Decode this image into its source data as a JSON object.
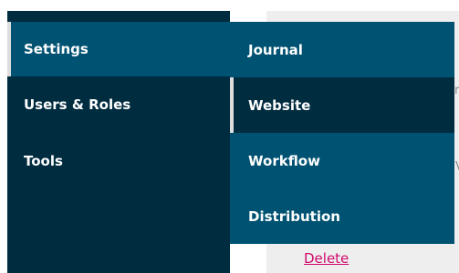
{
  "main_nav": {
    "items": [
      {
        "label": "Settings",
        "active": true
      },
      {
        "label": "Users & Roles",
        "active": false
      },
      {
        "label": "Tools",
        "active": false
      }
    ]
  },
  "settings_submenu": {
    "items": [
      {
        "label": "Journal",
        "active": false
      },
      {
        "label": "Website",
        "active": true
      },
      {
        "label": "Workflow",
        "active": false
      },
      {
        "label": "Distribution",
        "active": false
      }
    ]
  },
  "background": {
    "delete_link": "Delete",
    "fragment_1": "r",
    "fragment_2": "V"
  },
  "colors": {
    "nav_bg": "#002c40",
    "active_bg": "#005272",
    "submenu_bg": "#005272",
    "indicator": "#dddddd",
    "link": "#d00a6c"
  }
}
